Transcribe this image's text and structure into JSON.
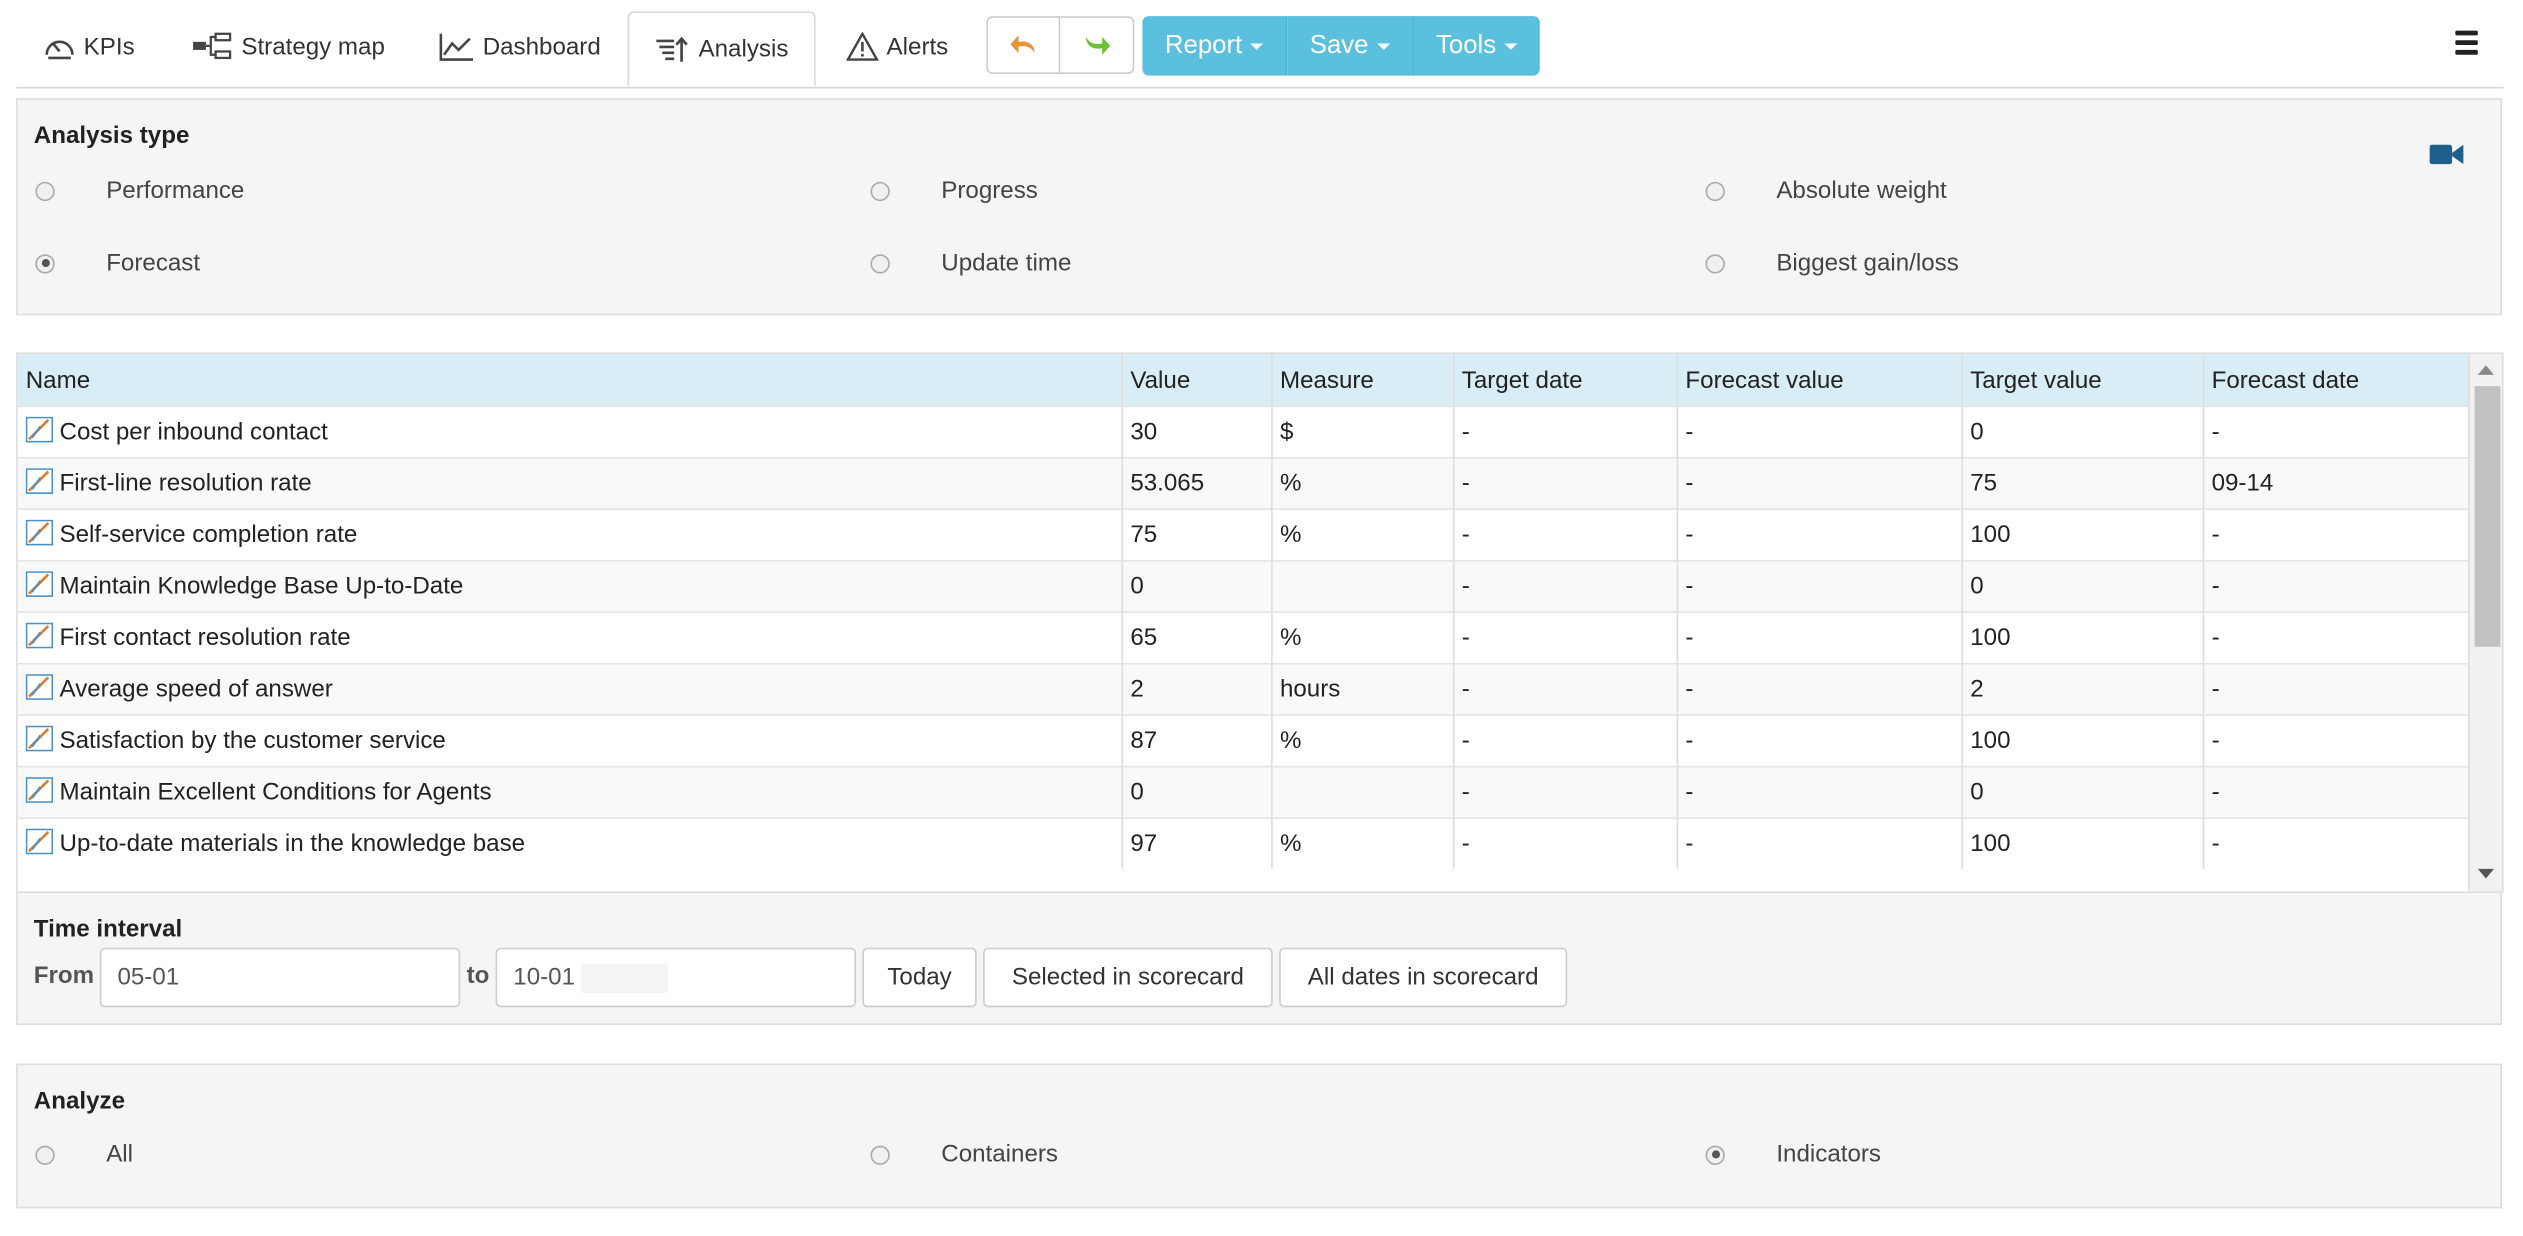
{
  "tabs": [
    {
      "label": "KPIs",
      "icon": "gauge-icon"
    },
    {
      "label": "Strategy map",
      "icon": "strategy-map-icon"
    },
    {
      "label": "Dashboard",
      "icon": "line-chart-icon"
    },
    {
      "label": "Analysis",
      "icon": "sort-amount-icon"
    },
    {
      "label": "Alerts",
      "icon": "warning-icon"
    }
  ],
  "toolbar": {
    "report": "Report",
    "save": "Save",
    "tools": "Tools"
  },
  "analysis_type": {
    "title": "Analysis type",
    "options": [
      "Performance",
      "Progress",
      "Absolute weight",
      "Forecast",
      "Update time",
      "Biggest gain/loss"
    ],
    "selected": "Forecast"
  },
  "table": {
    "columns": [
      "Name",
      "Value",
      "Measure",
      "Target date",
      "Forecast value",
      "Target value",
      "Forecast date"
    ],
    "rows": [
      [
        "Cost per inbound contact",
        "30",
        "$",
        "-",
        "-",
        "0",
        "-"
      ],
      [
        "First-line resolution rate",
        "53.065",
        "%",
        "-",
        "-",
        "75",
        "09-14"
      ],
      [
        "Self-service completion rate",
        "75",
        "%",
        "-",
        "-",
        "100",
        "-"
      ],
      [
        "Maintain Knowledge Base Up-to-Date",
        "0",
        "",
        "-",
        "-",
        "0",
        "-"
      ],
      [
        "First contact resolution rate",
        "65",
        "%",
        "-",
        "-",
        "100",
        "-"
      ],
      [
        "Average speed of answer",
        "2",
        "hours",
        "-",
        "-",
        "2",
        "-"
      ],
      [
        "Satisfaction by the customer service",
        "87",
        "%",
        "-",
        "-",
        "100",
        "-"
      ],
      [
        "Maintain Excellent Conditions for Agents",
        "0",
        "",
        "-",
        "-",
        "0",
        "-"
      ],
      [
        "Up-to-date materials in the knowledge base",
        "97",
        "%",
        "-",
        "-",
        "100",
        "-"
      ]
    ]
  },
  "time_interval": {
    "title": "Time interval",
    "from_label": "From",
    "to_label": "to",
    "from_value": "05-01",
    "to_value": "10-01",
    "today": "Today",
    "selected": "Selected in scorecard",
    "all_dates": "All dates in scorecard"
  },
  "analyze": {
    "title": "Analyze",
    "options": [
      "All",
      "Containers",
      "Indicators"
    ],
    "selected": "Indicators"
  },
  "colors": {
    "info_button": "#5bc0de",
    "header_row": "#d9edf7",
    "camera_icon": "#1f5f8b"
  }
}
